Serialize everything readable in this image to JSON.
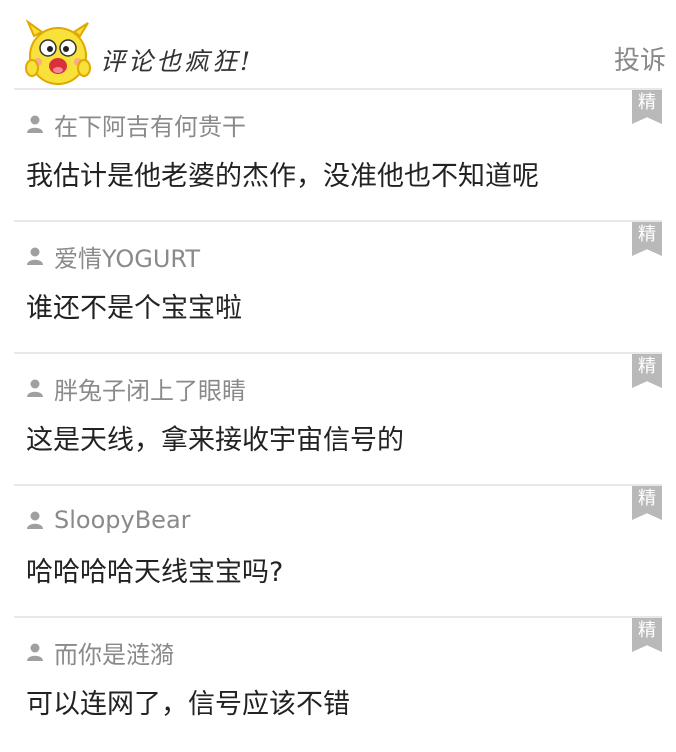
{
  "header": {
    "title": "评论也疯狂!",
    "report_label": "投诉",
    "mascot_icon": "yellow-cartoon-mascot"
  },
  "badge_label": "精",
  "comments": [
    {
      "author": "在下阿吉有何贵干",
      "text": "我估计是他老婆的杰作，没准他也不知道呢"
    },
    {
      "author": "爱情YOGURT",
      "text": "谁还不是个宝宝啦"
    },
    {
      "author": "胖兔子闭上了眼睛",
      "text": "这是天线，拿来接收宇宙信号的"
    },
    {
      "author": "SloopyBear",
      "text": "哈哈哈哈天线宝宝吗?"
    },
    {
      "author": "而你是涟漪",
      "text": "可以连网了，信号应该不错"
    }
  ],
  "colors": {
    "divider": "#e8e8e8",
    "badge": "#b9b9b9",
    "author": "#8a8a8a",
    "text": "#222222",
    "report": "#888888"
  }
}
